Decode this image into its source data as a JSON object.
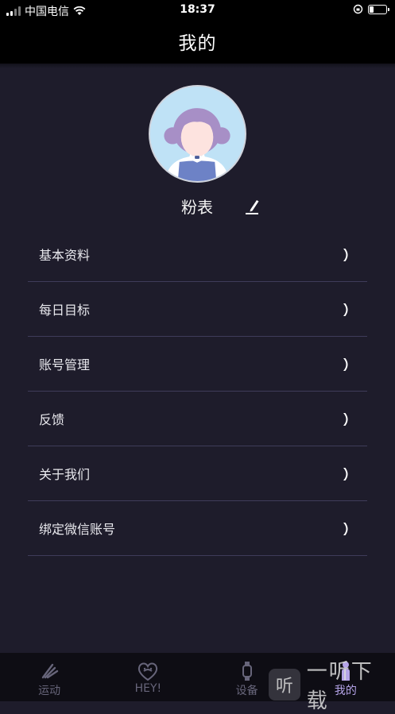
{
  "status_bar": {
    "carrier": "中国电信",
    "time": "18:37"
  },
  "header": {
    "title": "我的"
  },
  "profile": {
    "name": "粉表"
  },
  "menu": {
    "items": [
      {
        "label": "基本资料"
      },
      {
        "label": "每日目标"
      },
      {
        "label": "账号管理"
      },
      {
        "label": "反馈"
      },
      {
        "label": "关于我们"
      },
      {
        "label": "绑定微信账号"
      }
    ]
  },
  "tabs": [
    {
      "label": "运动",
      "icon": "shoe-icon"
    },
    {
      "label": "HEY!",
      "icon": "heart-face-icon"
    },
    {
      "label": "设备",
      "icon": "watch-icon"
    },
    {
      "label": "我的",
      "icon": "person-icon",
      "active": true
    }
  ],
  "watermark": {
    "logo": "听",
    "text": "一听下载"
  },
  "colors": {
    "background": "#1e1c2b",
    "header": "#000000",
    "divider": "#3f3c5a",
    "active_tab": "#b5a4e8"
  }
}
